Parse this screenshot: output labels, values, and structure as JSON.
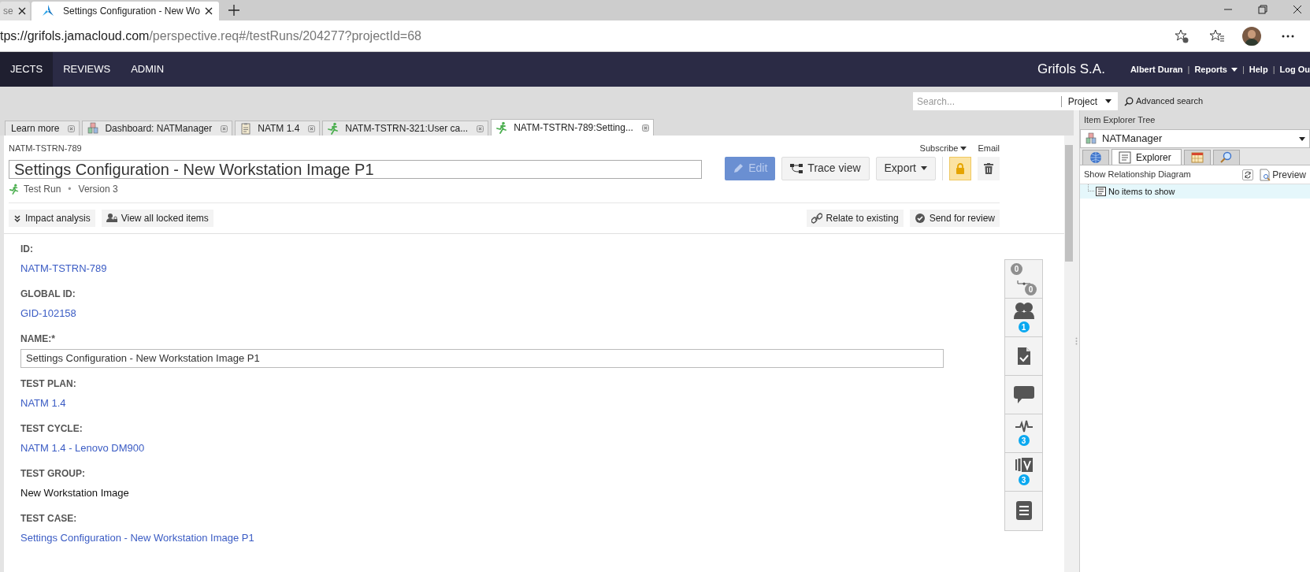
{
  "browser": {
    "tabs": [
      {
        "title": "se",
        "selected": false
      },
      {
        "title": "Settings Configuration - New Wo",
        "selected": true
      }
    ],
    "url_host": "tps://grifols.jamacloud.com",
    "url_path": "/perspective.req#/testRuns/204277?projectId=68"
  },
  "nav": {
    "items": [
      {
        "label": "JECTS",
        "selected": true
      },
      {
        "label": "REVIEWS",
        "selected": false
      },
      {
        "label": "ADMIN",
        "selected": false
      }
    ],
    "brand": "Grifols S.A.",
    "separator": "|",
    "user_links": [
      {
        "label": "Albert Duran",
        "caret": false
      },
      {
        "label": "Reports",
        "caret": true
      },
      {
        "label": "Help",
        "caret": false
      },
      {
        "label": "Log Ou",
        "caret": false
      }
    ]
  },
  "search": {
    "placeholder": "Search...",
    "scope": "Project",
    "advanced": "Advanced search"
  },
  "doc_tabs": [
    {
      "label": "Learn more",
      "kind": "plain",
      "selected": false
    },
    {
      "label": "Dashboard: NATManager",
      "kind": "project",
      "selected": false
    },
    {
      "label": "NATM 1.4",
      "kind": "plan",
      "selected": false
    },
    {
      "label": "NATM-TSTRN-321:User ca...",
      "kind": "run",
      "selected": false
    },
    {
      "label": "NATM-TSTRN-789:Setting...",
      "kind": "run",
      "selected": true
    }
  ],
  "item": {
    "key": "NATM-TSTRN-789",
    "subscribe": "Subscribe",
    "email": "Email",
    "title": "Settings Configuration - New Workstation Image P1",
    "type": "Test Run",
    "separator": "•",
    "version": "Version 3",
    "actions": [
      {
        "kind": "edit",
        "label": "Edit",
        "disabled": true
      },
      {
        "kind": "trace",
        "label": "Trace view",
        "disabled": false
      },
      {
        "kind": "export",
        "label": "Export",
        "disabled": false
      }
    ],
    "lock": {
      "on": true
    },
    "left_tools": [
      {
        "kind": "impact",
        "label": "Impact analysis"
      },
      {
        "kind": "locked",
        "label": "View all locked items"
      }
    ],
    "right_tools": [
      {
        "kind": "relate",
        "label": "Relate to existing"
      },
      {
        "kind": "review",
        "label": "Send for review"
      }
    ]
  },
  "fields": [
    {
      "label": "ID:",
      "kind": "link",
      "value": "NATM-TSTRN-789"
    },
    {
      "label": "GLOBAL ID:",
      "kind": "link",
      "value": "GID-102158"
    },
    {
      "label": "NAME:*",
      "kind": "input",
      "value": "Settings Configuration - New Workstation Image P1"
    },
    {
      "label": "TEST PLAN:",
      "kind": "link",
      "value": "NATM 1.4"
    },
    {
      "label": "TEST CYCLE:",
      "kind": "link",
      "value": "NATM 1.4 - Lenovo DM900"
    },
    {
      "label": "TEST GROUP:",
      "kind": "text",
      "value": "New Workstation Image"
    },
    {
      "label": "TEST CASE:",
      "kind": "link",
      "value": "Settings Configuration - New Workstation Image P1"
    }
  ],
  "widgets": [
    {
      "kind": "relations",
      "badges": [
        "0",
        "0"
      ]
    },
    {
      "kind": "people",
      "badges": [
        "1"
      ]
    },
    {
      "kind": "tests"
    },
    {
      "kind": "comments"
    },
    {
      "kind": "activity",
      "badges": [
        "3"
      ]
    },
    {
      "kind": "versions",
      "badges": [
        "3"
      ]
    },
    {
      "kind": "list"
    }
  ],
  "explorer": {
    "title": "Item Explorer Tree",
    "project": "NATManager",
    "tabs": [
      {
        "kind": "globe",
        "selected": false
      },
      {
        "kind": "explorer",
        "label": "Explorer",
        "selected": true
      },
      {
        "kind": "calendar",
        "selected": false
      },
      {
        "kind": "search",
        "selected": false
      }
    ],
    "diagram": "Show Relationship Diagram",
    "preview": "Preview",
    "empty": "No items to show"
  }
}
